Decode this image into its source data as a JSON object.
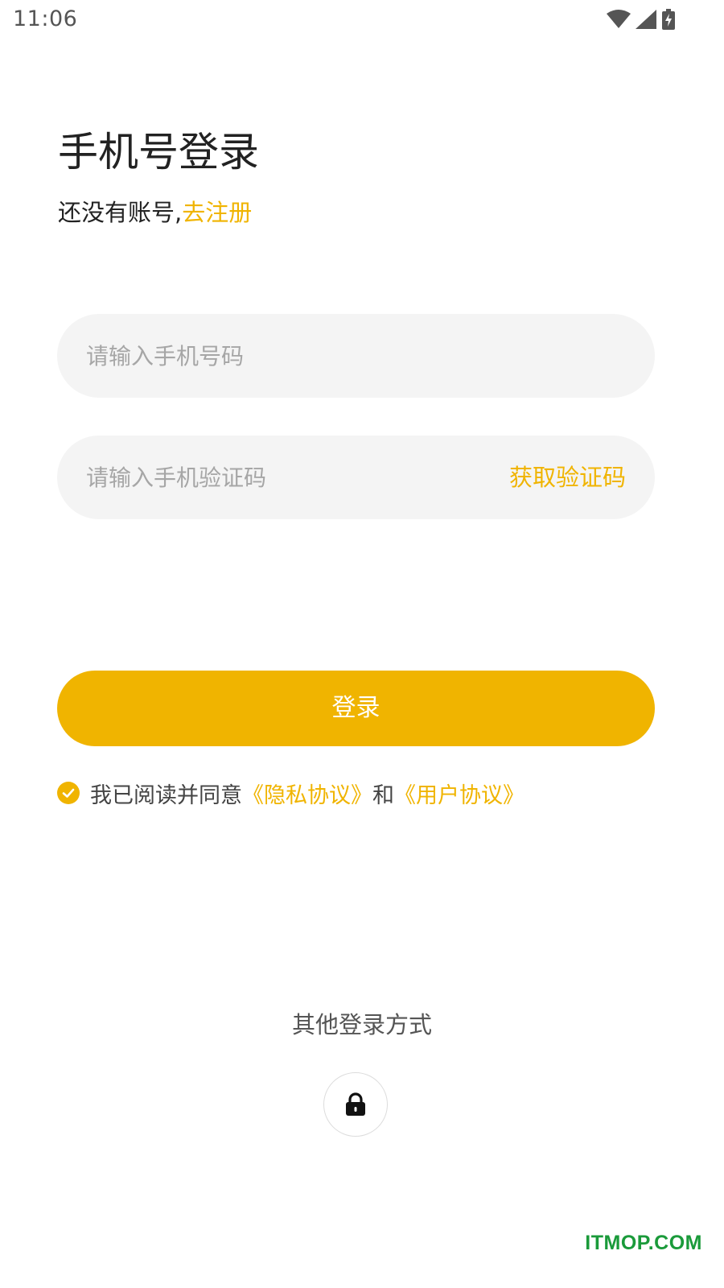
{
  "status_bar": {
    "time": "11:06",
    "icons": [
      "wifi-icon",
      "signal-icon",
      "battery-charging-icon"
    ]
  },
  "header": {
    "title": "手机号登录",
    "subtitle_prefix": "还没有账号,",
    "register_link": "去注册"
  },
  "form": {
    "phone": {
      "placeholder": "请输入手机号码",
      "value": ""
    },
    "code": {
      "placeholder": "请输入手机验证码",
      "value": "",
      "get_code_label": "获取验证码"
    },
    "login_label": "登录"
  },
  "agreement": {
    "checked": true,
    "text_prefix": "我已阅读并同意",
    "privacy_link": "《隐私协议》",
    "conjunction": "和",
    "user_link": "《用户协议》"
  },
  "other_login": {
    "title": "其他登录方式",
    "icon": "lock-icon"
  },
  "watermark": "ITMOP.COM",
  "colors": {
    "accent": "#f0b400",
    "field_background": "#f4f4f4",
    "watermark": "#1a9a3a"
  }
}
